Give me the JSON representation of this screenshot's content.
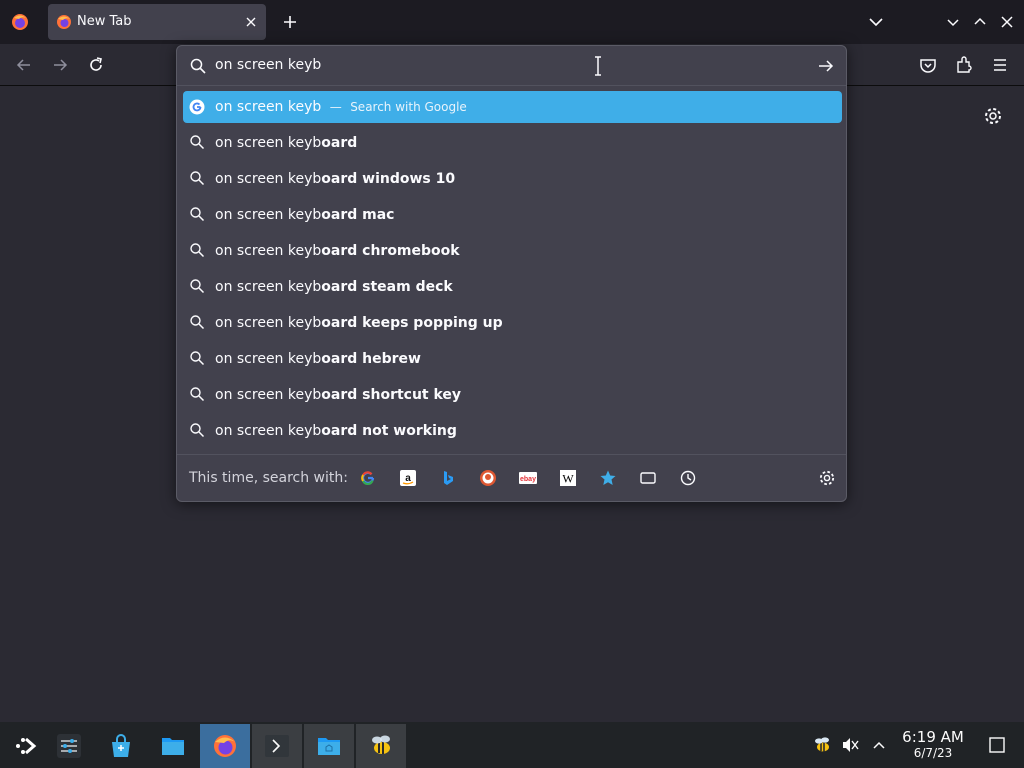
{
  "tab": {
    "title": "New Tab"
  },
  "urlbar": {
    "value": "on screen keyb"
  },
  "results": [
    {
      "typed": "on screen keyb",
      "completion": "",
      "hint": "Search with Google",
      "separator": "—"
    },
    {
      "typed": "on screen keyb",
      "completion": "oard"
    },
    {
      "typed": "on screen keyb",
      "completion": "oard windows 10"
    },
    {
      "typed": "on screen keyb",
      "completion": "oard mac"
    },
    {
      "typed": "on screen keyb",
      "completion": "oard chromebook"
    },
    {
      "typed": "on screen keyb",
      "completion": "oard steam deck"
    },
    {
      "typed": "on screen keyb",
      "completion": "oard keeps popping up"
    },
    {
      "typed": "on screen keyb",
      "completion": "oard hebrew"
    },
    {
      "typed": "on screen keyb",
      "completion": "oard shortcut key"
    },
    {
      "typed": "on screen keyb",
      "completion": "oard not working"
    }
  ],
  "one_offs": {
    "label": "This time, search with:",
    "engines": [
      "google-icon",
      "amazon-icon",
      "bing-icon",
      "duckduckgo-icon",
      "ebay-icon",
      "wikipedia-icon",
      "bookmarks-icon",
      "tabs-icon",
      "history-icon"
    ]
  },
  "clock": {
    "time": "6:19 AM",
    "date": "6/7/23"
  },
  "colors": {
    "accent": "#3faee8",
    "popup_bg": "#42414d",
    "page_bg": "#2b2a33",
    "taskbar_active": "#3b6e9e"
  }
}
